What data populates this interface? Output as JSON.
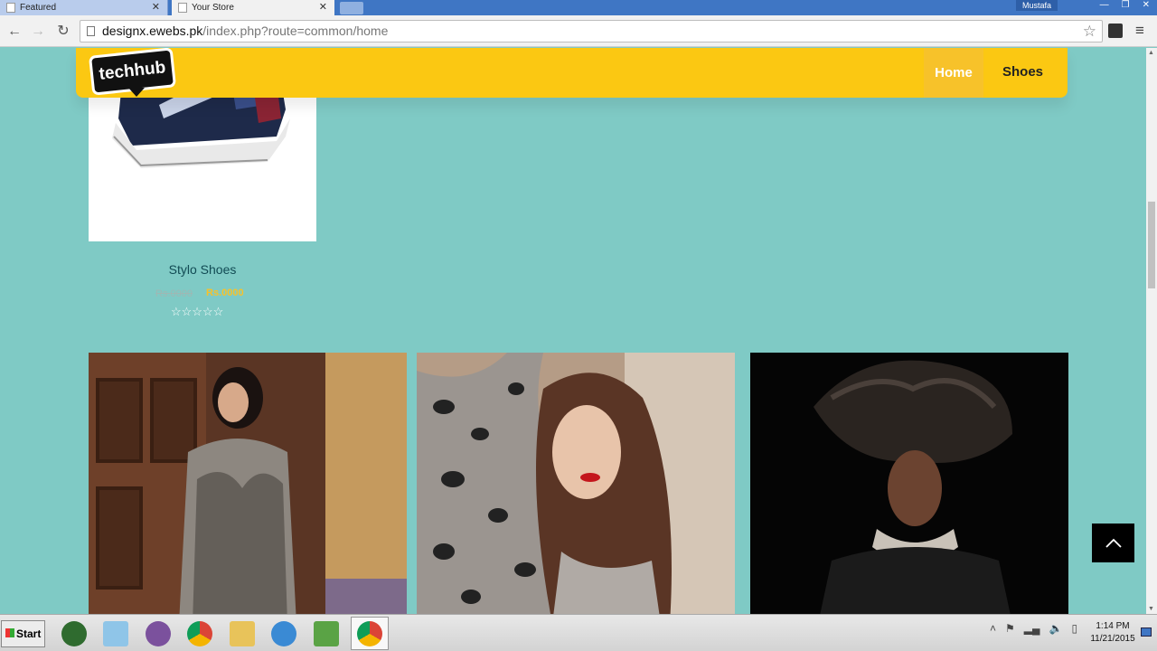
{
  "browser": {
    "tabs": [
      {
        "label": "Featured",
        "active": false
      },
      {
        "label": "Your Store",
        "active": true
      }
    ],
    "user": "Mustafa",
    "url_domain": "designx.ewebs.pk",
    "url_path": "/index.php?route=common/home"
  },
  "site": {
    "logo_text": "techhub",
    "nav": [
      {
        "label": "Home",
        "active": true
      },
      {
        "label": "Shoes",
        "active": false
      }
    ]
  },
  "product": {
    "name": "Stylo Shoes",
    "rating_stars": "☆☆☆☆☆"
  },
  "taskbar": {
    "start_label": "Start",
    "time": "1:14 PM",
    "date": "11/21/2015"
  },
  "colors": {
    "page_bg": "#7fcac5",
    "header": "#fbc812",
    "accent": "#f7c22a"
  }
}
